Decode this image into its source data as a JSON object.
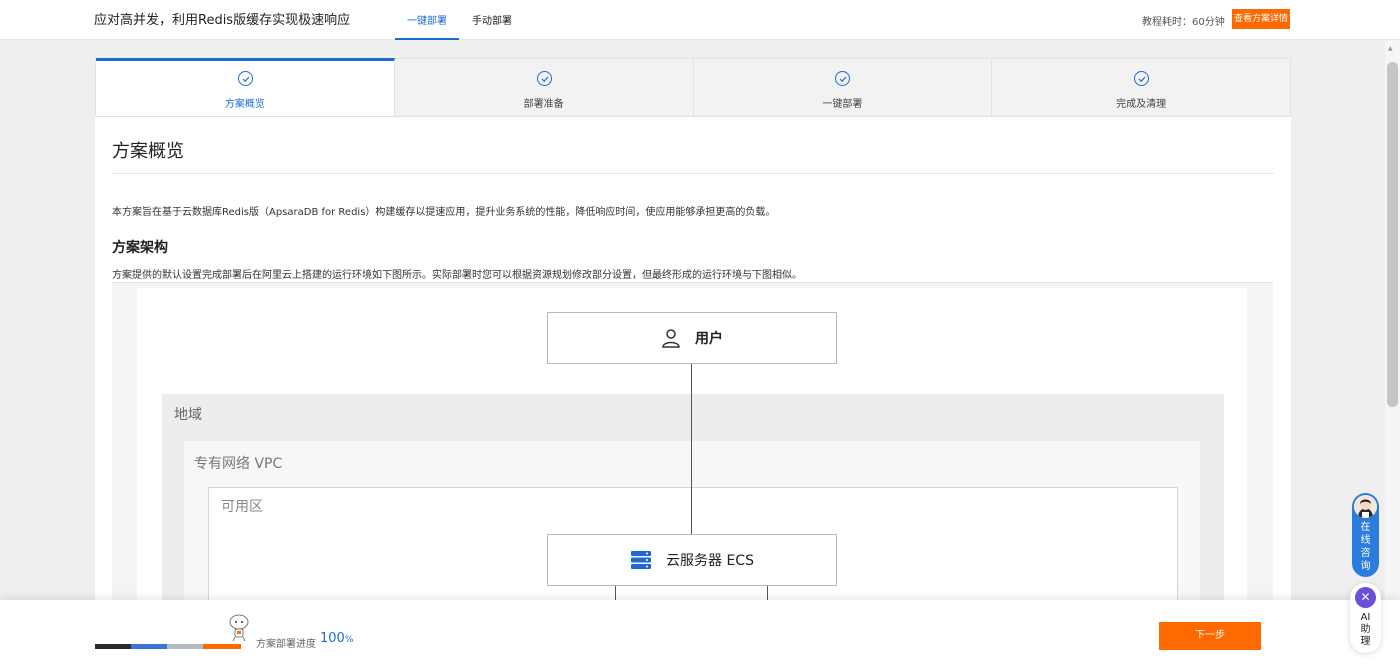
{
  "header": {
    "title": "应对高并发，利用Redis版缓存实现极速响应",
    "tabs": [
      {
        "label": "一键部署",
        "active": true
      },
      {
        "label": "手动部署",
        "active": false
      }
    ],
    "duration": "教程耗时：60分钟",
    "detail_button": "查看方案详情"
  },
  "steps": [
    {
      "label": "方案概览",
      "active": true,
      "done": true
    },
    {
      "label": "部署准备",
      "active": false,
      "done": true
    },
    {
      "label": "一键部署",
      "active": false,
      "done": true
    },
    {
      "label": "完成及清理",
      "active": false,
      "done": true
    }
  ],
  "content": {
    "title": "方案概览",
    "intro": "本方案旨在基于云数据库Redis版（ApsaraDB for Redis）构建缓存以提速应用，提升业务系统的性能，降低响应时间，使应用能够承担更高的负载。",
    "arch_title": "方案架构",
    "arch_desc": "方案提供的默认设置完成部署后在阿里云上搭建的运行环境如下图所示。实际部署时您可以根据资源规划修改部分设置，但最终形成的运行环境与下图相似。"
  },
  "diagram": {
    "user_label": "用户",
    "region_label": "地域",
    "vpc_label": "专有网络 VPC",
    "az_label": "可用区",
    "ecs_label": "云服务器 ECS"
  },
  "footer": {
    "progress_label": "方案部署进度",
    "progress_value": "100",
    "progress_unit": "%",
    "progress_fraction": 1.0,
    "next_button": "下一步"
  },
  "widgets": {
    "consult_label": "在线咨询",
    "ai_label": "AI助理"
  },
  "colors": {
    "accent": "#1c6bd3",
    "brand_orange": "#ff6a00",
    "ai_purple": "#6a4fd8"
  }
}
